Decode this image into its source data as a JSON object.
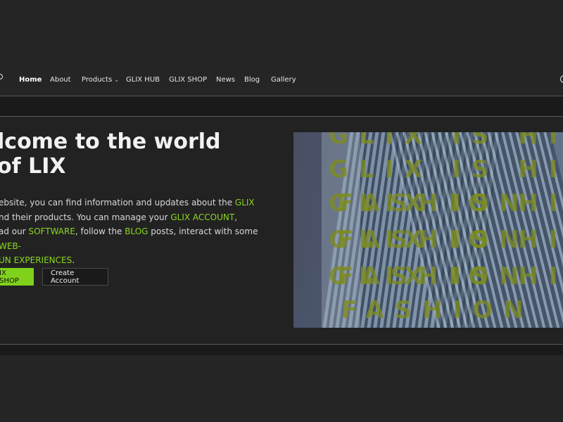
{
  "nav": {
    "items": [
      {
        "label": "Home",
        "active": true
      },
      {
        "label": "About"
      },
      {
        "label": "Products",
        "has_dropdown": true
      },
      {
        "label": "GLIX HUB"
      },
      {
        "label": "GLIX SHOP"
      },
      {
        "label": "News"
      },
      {
        "label": "Blog"
      },
      {
        "label": "Gallery"
      }
    ],
    "dropdown_icon": "chevron-down-icon",
    "chevron": "⌄"
  },
  "hero": {
    "title": "lcome to the world of LIX",
    "description": {
      "t1": "ebsite, you can find information and updates about the ",
      "h1": "GLIX",
      "t2": "nd their products. You can manage your ",
      "h2": "GLIX ACCOUNT",
      "t3": ",",
      "t4": "ad our ",
      "h3": "SOFTWARE",
      "t5": ", follow the ",
      "h4": "BLOG",
      "t6": " posts, interact with some ",
      "h5": "WEB-",
      "h6": "UN EXPERIENCES",
      "t7": "."
    },
    "buttons": {
      "primary": "IX SHOP",
      "secondary": "Create Account"
    },
    "visual": {
      "overlay_lines": [
        "GLIX IS HI",
        "GLIX IS HI",
        "GLIX IS HI",
        "FASHION",
        "GLIX IS HI",
        "FASHION",
        "GLIX IS HI",
        "FASHION",
        "FASHION"
      ]
    }
  },
  "colors": {
    "accent": "#7fd11b",
    "background": "#252525",
    "dark_band": "#1a1a1a"
  }
}
